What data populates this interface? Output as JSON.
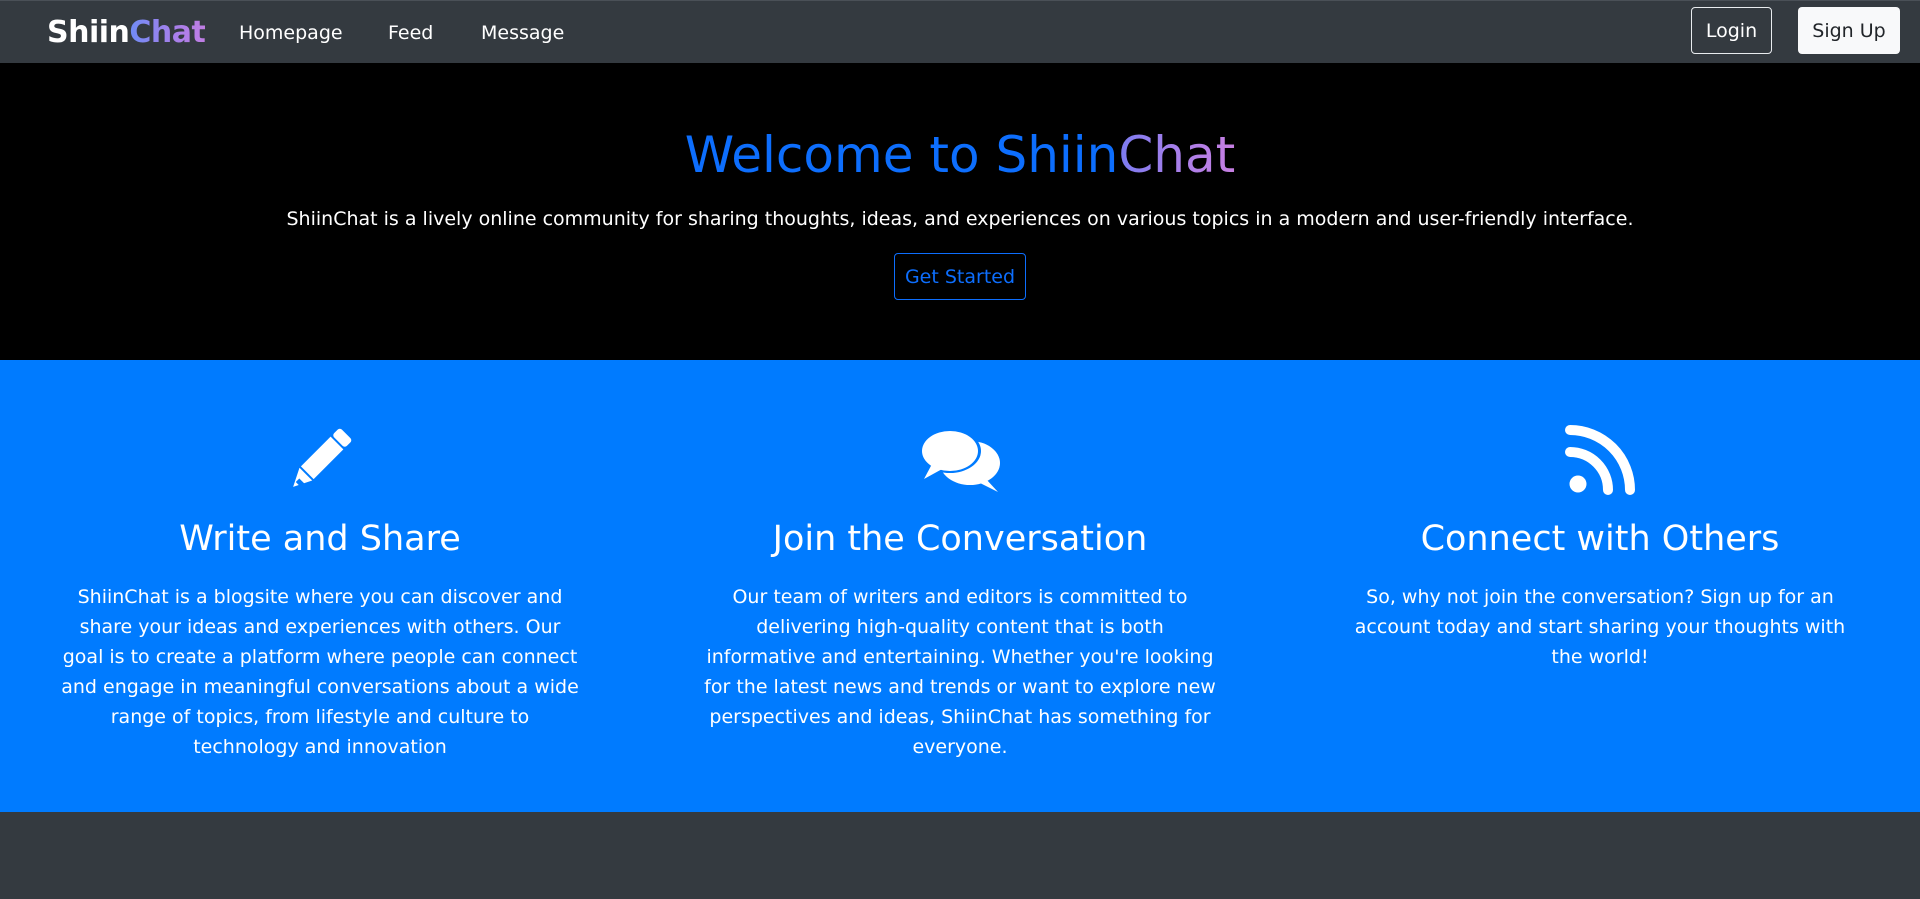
{
  "navbar": {
    "brand_part1": "Shiin",
    "brand_part2": "Chat",
    "links": [
      "Homepage",
      "Feed",
      "Message"
    ],
    "login_label": "Login",
    "signup_label": "Sign Up"
  },
  "hero": {
    "title_part1": "Welcome to ",
    "title_part2": "Shiin",
    "title_part3": "Chat",
    "subtitle": "ShiinChat is a lively online community for sharing thoughts, ideas, and experiences on various topics in a modern and user-friendly interface.",
    "cta_label": "Get Started"
  },
  "features": [
    {
      "icon": "pencil-icon",
      "title": "Write and Share",
      "text": "ShiinChat is a blogsite where you can discover and share your ideas and experiences with others. Our goal is to create a platform where people can connect and engage in meaningful conversations about a wide range of topics, from lifestyle and culture to technology and innovation"
    },
    {
      "icon": "chat-bubbles-icon",
      "title": "Join the Conversation",
      "text": "Our team of writers and editors is committed to delivering high-quality content that is both informative and entertaining. Whether you're looking for the latest news and trends or want to explore new perspectives and ideas, ShiinChat has something for everyone."
    },
    {
      "icon": "rss-icon",
      "title": "Connect with Others",
      "text": "So, why not join the conversation? Sign up for an account today and start sharing your thoughts with the world!"
    }
  ],
  "colors": {
    "navbar_bg": "#343a40",
    "hero_bg": "#000000",
    "features_bg": "#007bff",
    "accent": "#0d6efd"
  }
}
